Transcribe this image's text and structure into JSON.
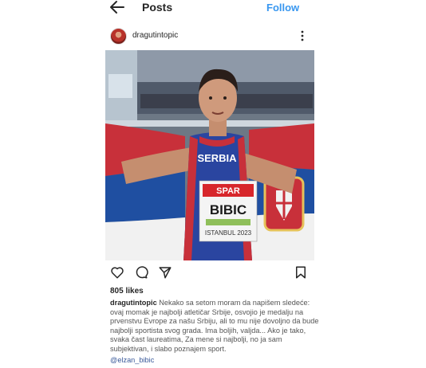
{
  "header": {
    "title": "Posts",
    "follow_label": "Follow",
    "back_icon": "back-arrow-icon"
  },
  "post": {
    "username": "dragutintopic",
    "more_icon": "more-vertical-icon",
    "image": {
      "jersey_top": "SERBIA",
      "sponsor": "SPAR",
      "bib_name": "BIBIC",
      "bib_sub": "ISTANBUL 2023"
    },
    "actions": [
      "heart-icon",
      "comment-icon",
      "share-icon",
      "bookmark-icon"
    ],
    "likes": "805 likes",
    "caption_user": "dragutintopic",
    "caption_text": "Nekako sa setom moram da napišem sledeće: ovaj momak je najbolji atletičar Srbije, osvojio je medalju na prvenstvu Evrope za našu Srbiju, ali to mu nije dovoljno da bude najbolji sportista svog grada. Ima boljih, valjda... Ako je tako, svaka čast laureatima,  Za mene si najbolji, no ja sam subjektivan, i slabo poznajem sport.",
    "mention": "@elzan_bibic"
  }
}
